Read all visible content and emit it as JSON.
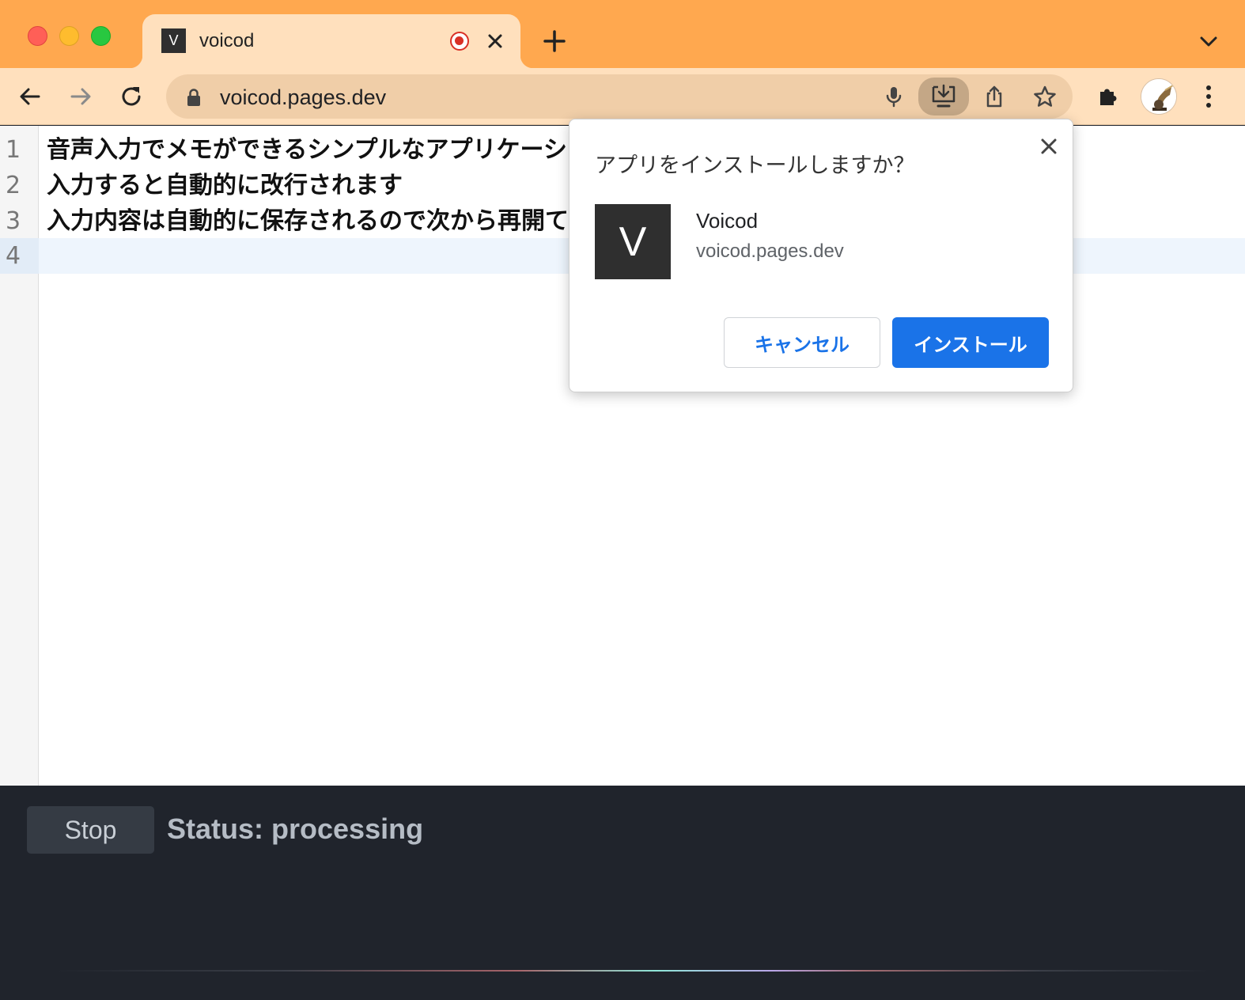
{
  "browser": {
    "tab": {
      "favicon_letter": "V",
      "title": "voicod"
    },
    "toolbar": {
      "url": "voicod.pages.dev"
    },
    "colors": {
      "tabstrip": "#ffa84f",
      "toolbar": "#ffe0bd",
      "accent": "#1a73e8"
    }
  },
  "editor": {
    "lines": [
      {
        "number": "1",
        "text": "音声入力でメモができるシンプルなアプリケーショ"
      },
      {
        "number": "2",
        "text": "入力すると自動的に改行されます"
      },
      {
        "number": "3",
        "text": "入力内容は自動的に保存されるので次から再開て"
      },
      {
        "number": "4",
        "text": ""
      }
    ],
    "active_line": 4
  },
  "install_dialog": {
    "title": "アプリをインストールしますか？",
    "app_icon_letter": "V",
    "app_name": "Voicod",
    "app_origin": "voicod.pages.dev",
    "cancel_label": "キャンセル",
    "install_label": "インストール"
  },
  "panel": {
    "stop_label": "Stop",
    "status_text": "Status: processing"
  }
}
